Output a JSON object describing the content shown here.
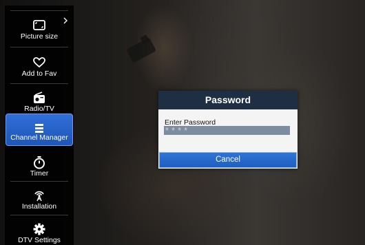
{
  "menu": {
    "items": [
      {
        "label": "Picture size",
        "icon": "picture-size-icon"
      },
      {
        "label": "Add to Fav",
        "icon": "heart-icon"
      },
      {
        "label": "Radio/TV",
        "icon": "radio-icon"
      },
      {
        "label": "Channel Manager",
        "icon": "list-icon",
        "selected": true
      },
      {
        "label": "Timer",
        "icon": "timer-icon"
      },
      {
        "label": "Installation",
        "icon": "antenna-icon"
      },
      {
        "label": "DTV Settings",
        "icon": "gear-icon"
      }
    ]
  },
  "dialog": {
    "title": "Password",
    "prompt": "Enter Password",
    "password_mask": "****",
    "cancel_label": "Cancel"
  },
  "colors": {
    "menu_selected": "#2f6fd8",
    "dialog_title_bg": "#1e2f44",
    "button_bg": "#2e74d6",
    "field_bg": "#7d8da0"
  }
}
